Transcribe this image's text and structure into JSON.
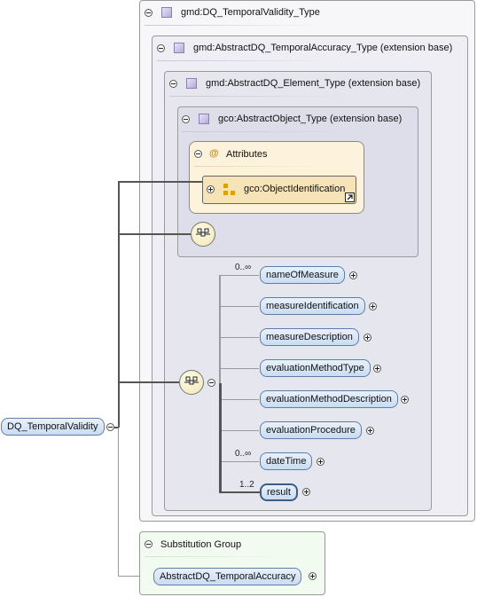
{
  "types": [
    {
      "label": "gmd:DQ_TemporalValidity_Type"
    },
    {
      "label": "gmd:AbstractDQ_TemporalAccuracy_Type (extension base)"
    },
    {
      "label": "gmd:AbstractDQ_Element_Type (extension base)"
    },
    {
      "label": "gco:AbstractObject_Type (extension base)"
    }
  ],
  "attributes": {
    "title": "Attributes",
    "at_symbol": "@",
    "item": "gco:ObjectIdentification"
  },
  "root_element": "DQ_TemporalValidity",
  "sequence_elements": [
    {
      "label": "nameOfMeasure",
      "cardinality": "0..∞"
    },
    {
      "label": "measureIdentification",
      "cardinality": ""
    },
    {
      "label": "measureDescription",
      "cardinality": ""
    },
    {
      "label": "evaluationMethodType",
      "cardinality": ""
    },
    {
      "label": "evaluationMethodDescription",
      "cardinality": ""
    },
    {
      "label": "evaluationProcedure",
      "cardinality": ""
    },
    {
      "label": "dateTime",
      "cardinality": "0..∞"
    },
    {
      "label": "result",
      "cardinality": "1..2"
    }
  ],
  "substitution_group": {
    "title": "Substitution Group",
    "element": "AbstractDQ_TemporalAccuracy"
  },
  "colors": {
    "element_fill": "#c9dcf2",
    "element_border": "#5d7ea8",
    "attributes_fill": "#fdf3dc",
    "substitution_fill": "#f1fbef",
    "type_icon": "#b6a9d8"
  }
}
